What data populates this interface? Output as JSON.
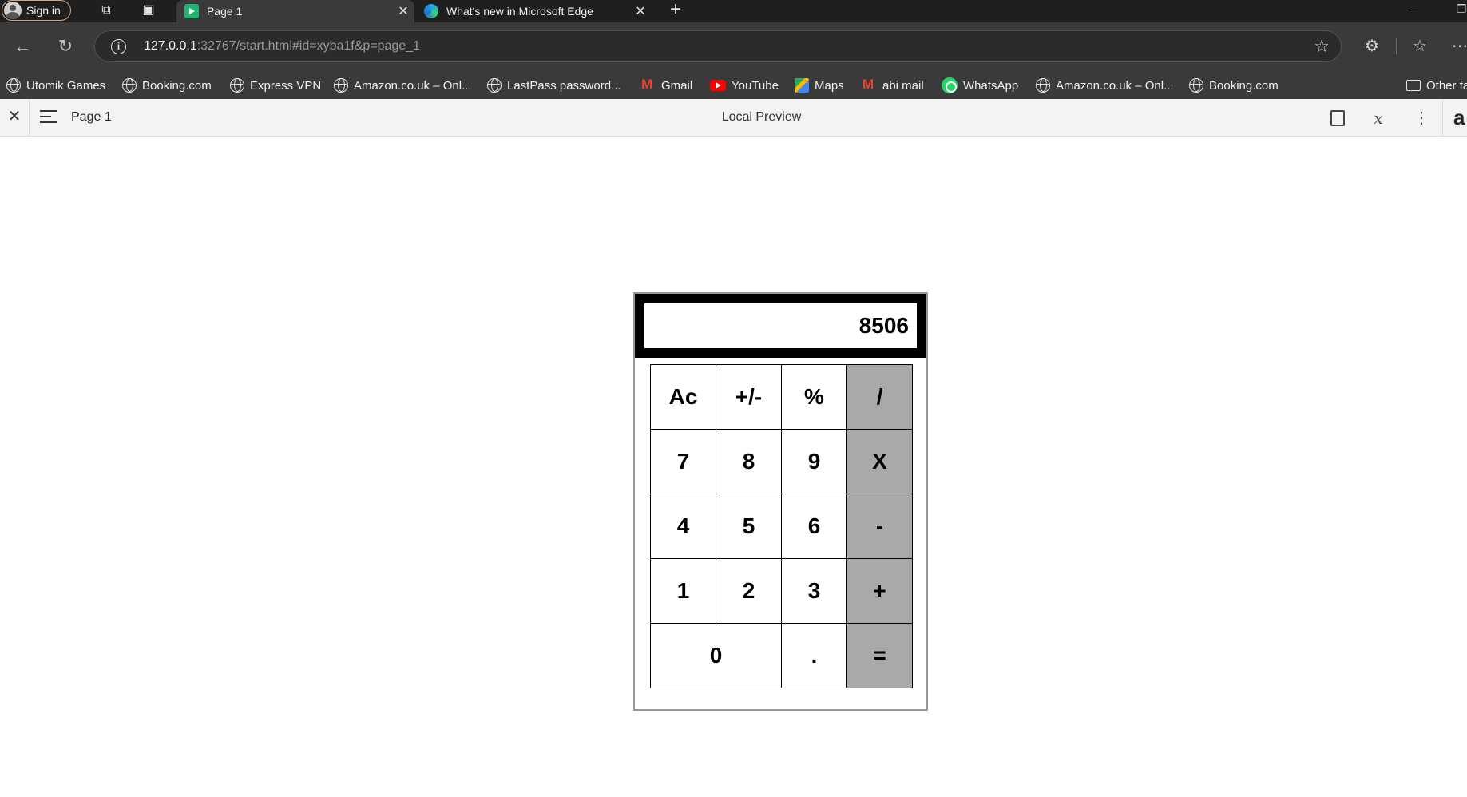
{
  "browser": {
    "signin_label": "Sign in",
    "tabs": [
      {
        "title": "Page 1",
        "active": true
      },
      {
        "title": "What's new in Microsoft Edge",
        "active": false
      }
    ],
    "url_host": "127.0.0.1",
    "url_rest": ":32767/start.html#id=xyba1f&p=page_1",
    "bookmarks": [
      {
        "label": "Utomik Games",
        "icon": "globe-icon"
      },
      {
        "label": "Booking.com",
        "icon": "globe-icon"
      },
      {
        "label": "Express VPN",
        "icon": "globe-icon"
      },
      {
        "label": "Amazon.co.uk – Onl...",
        "icon": "globe-icon"
      },
      {
        "label": "LastPass password...",
        "icon": "globe-icon"
      },
      {
        "label": "Gmail",
        "icon": "gmail-icon"
      },
      {
        "label": "YouTube",
        "icon": "youtube-icon"
      },
      {
        "label": "Maps",
        "icon": "maps-icon"
      },
      {
        "label": "abi mail",
        "icon": "gmail-icon"
      },
      {
        "label": "WhatsApp",
        "icon": "whatsapp-icon"
      },
      {
        "label": "Amazon.co.uk – Onl...",
        "icon": "globe-icon"
      },
      {
        "label": "Booking.com",
        "icon": "globe-icon"
      }
    ],
    "other_favorites": "Other fa"
  },
  "preview": {
    "page_label": "Page 1",
    "title": "Local Preview",
    "right_glyph": "a"
  },
  "calculator": {
    "display": "8506",
    "keys": {
      "ac": "Ac",
      "sign": "+/-",
      "percent": "%",
      "divide": "/",
      "seven": "7",
      "eight": "8",
      "nine": "9",
      "multiply": "X",
      "four": "4",
      "five": "5",
      "six": "6",
      "minus": "-",
      "one": "1",
      "two": "2",
      "three": "3",
      "plus": "+",
      "zero": "0",
      "dot": ".",
      "equals": "="
    },
    "colors": {
      "operator_bg": "#a9a9a9",
      "screen_frame": "#000000"
    }
  }
}
